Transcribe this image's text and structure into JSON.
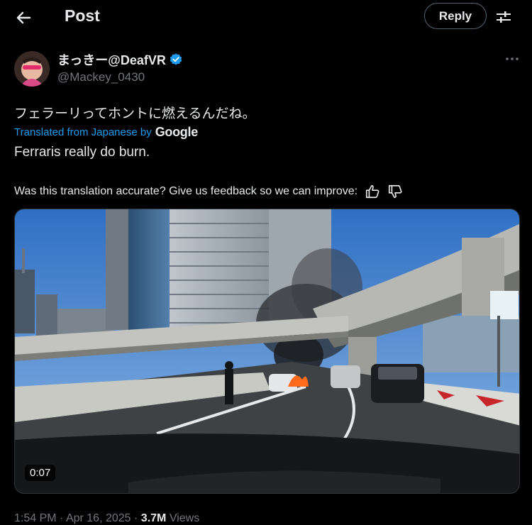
{
  "header": {
    "title": "Post",
    "reply_label": "Reply"
  },
  "author": {
    "name": "まっきー@DeafVR",
    "handle": "@Mackey_0430",
    "verified": true
  },
  "post": {
    "original_text": "フェラーリってホントに燃えるんだね。",
    "translated_from": "Translated from Japanese by",
    "translator": "Google",
    "translated_text": "Ferraris really do burn.",
    "feedback_prompt": "Was this translation accurate? Give us feedback so we can improve:"
  },
  "media": {
    "duration": "0:07"
  },
  "meta": {
    "time": "1:54 PM",
    "separator": "·",
    "date": "Apr 16, 2025",
    "views_count": "3.7M",
    "views_label": "Views"
  },
  "colors": {
    "accent": "#1d9bf0",
    "background": "#000000",
    "text": "#e7e9ea",
    "muted": "#71767b"
  },
  "icons": [
    "back-arrow-icon",
    "filter-sliders-icon",
    "verified-badge-icon",
    "more-icon",
    "thumbs-up-icon",
    "thumbs-down-icon",
    "google-logo"
  ]
}
